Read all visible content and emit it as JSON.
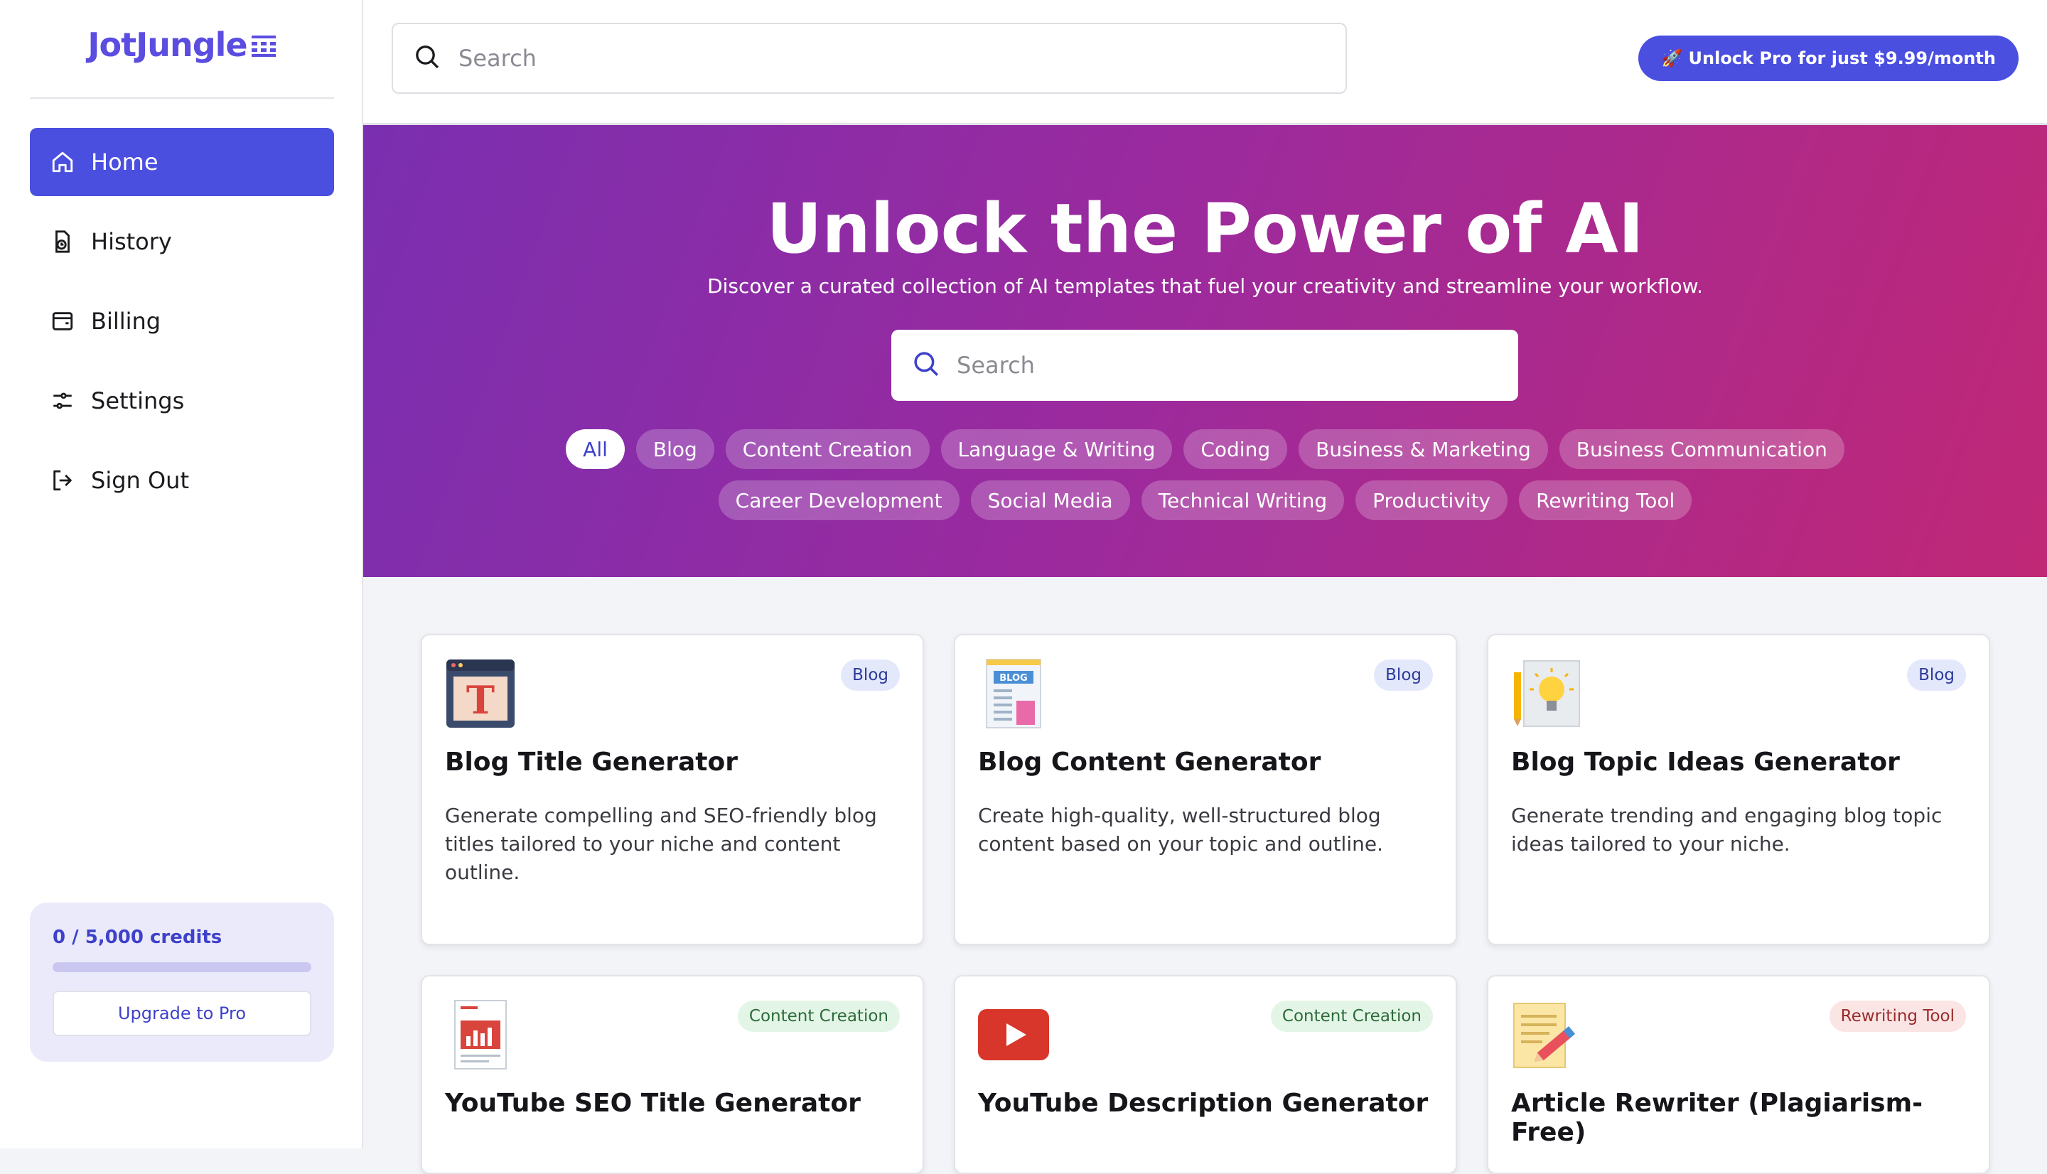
{
  "app": {
    "name": "JotJungle"
  },
  "sidebar": {
    "items": [
      {
        "label": "Home",
        "icon": "home-icon",
        "active": true
      },
      {
        "label": "History",
        "icon": "history-icon"
      },
      {
        "label": "Billing",
        "icon": "wallet-icon"
      },
      {
        "label": "Settings",
        "icon": "sliders-icon"
      },
      {
        "label": "Sign Out",
        "icon": "sign-out-icon"
      }
    ],
    "credits": {
      "label": "0 / 5,000 credits",
      "used": 0,
      "total": 5000
    },
    "upgrade_label": "Upgrade to Pro"
  },
  "header": {
    "search_placeholder": "Search",
    "pro_button": "🚀 Unlock Pro for just $9.99/month"
  },
  "hero": {
    "title": "Unlock the Power of AI",
    "subtitle": "Discover a curated collection of AI templates that fuel your creativity and streamline your workflow.",
    "search_placeholder": "Search",
    "categories_row1": [
      "All",
      "Blog",
      "Content Creation",
      "Language & Writing",
      "Coding",
      "Business & Marketing",
      "Business Communication"
    ],
    "categories_row2": [
      "Career Development",
      "Social Media",
      "Technical Writing",
      "Productivity",
      "Rewriting Tool"
    ],
    "active_category": "All"
  },
  "cards": [
    {
      "title": "Blog Title Generator",
      "badge": "Blog",
      "desc": "Generate compelling and SEO-friendly blog titles tailored to your niche and content outline.",
      "icon": "blog-title-icon"
    },
    {
      "title": "Blog Content Generator",
      "badge": "Blog",
      "desc": "Create high-quality, well-structured blog content based on your topic and outline.",
      "icon": "blog-content-icon"
    },
    {
      "title": "Blog Topic Ideas Generator",
      "badge": "Blog",
      "desc": "Generate trending and engaging blog topic ideas tailored to your niche.",
      "icon": "lightbulb-icon"
    },
    {
      "title": "YouTube SEO Title Generator",
      "badge": "Content Creation",
      "desc": "",
      "icon": "seo-report-icon"
    },
    {
      "title": "YouTube Description Generator",
      "badge": "Content Creation",
      "desc": "",
      "icon": "youtube-icon"
    },
    {
      "title": "Article Rewriter (Plagiarism-Free)",
      "badge": "Rewriting Tool",
      "desc": "",
      "icon": "document-pencil-icon"
    }
  ],
  "colors": {
    "accent": "#4a4fe0",
    "hero_start": "#7a2fb0",
    "hero_end": "#c02876"
  }
}
